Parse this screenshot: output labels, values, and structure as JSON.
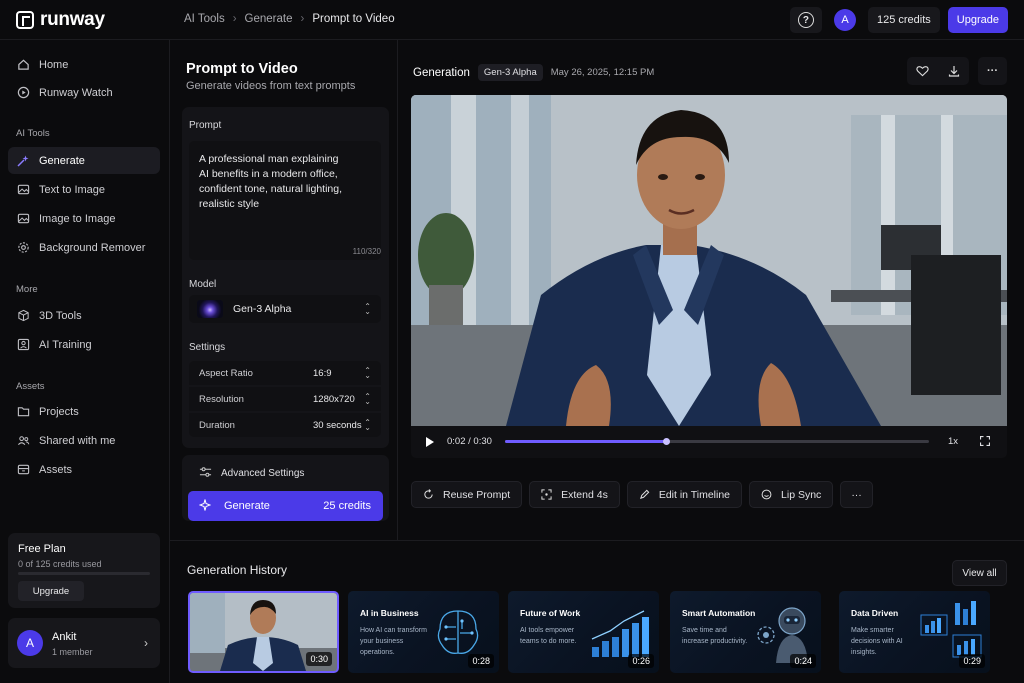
{
  "app": {
    "logo_text": "runway"
  },
  "breadcrumb": [
    "AI Tools",
    "Generate",
    "Prompt to Video"
  ],
  "header": {
    "avatar_initial": "A",
    "credits": "125 credits",
    "upgrade": "Upgrade"
  },
  "sidebar": {
    "top_items": [
      {
        "label": "Home",
        "icon": "home-icon"
      },
      {
        "label": "Runway Watch",
        "icon": "play-circle-icon"
      }
    ],
    "sections": {
      "ai_tools": "AI Tools",
      "more": "More",
      "assets": "Assets"
    },
    "ai_tools": [
      {
        "label": "Generate",
        "icon": "sparkle-icon",
        "active": true
      },
      {
        "label": "Text to Image",
        "icon": "image-icon"
      },
      {
        "label": "Image to Image",
        "icon": "image-icon"
      },
      {
        "label": "Background Remover",
        "icon": "gear-icon"
      }
    ],
    "more": [
      {
        "label": "3D Tools",
        "icon": "cube-icon"
      },
      {
        "label": "AI Training",
        "icon": "training-icon"
      }
    ],
    "assets": [
      {
        "label": "Projects",
        "icon": "folder-icon"
      },
      {
        "label": "Shared with me",
        "icon": "users-icon"
      },
      {
        "label": "Assets",
        "icon": "box-icon"
      }
    ],
    "plan": {
      "title": "Free Plan",
      "usage": "0 of 125 credits used",
      "used_fraction": 0,
      "button": "Upgrade"
    },
    "user": {
      "initial": "A",
      "name": "Ankit",
      "sub": "1 member"
    }
  },
  "panel": {
    "title": "Prompt to Video",
    "subtitle": "Generate videos from text prompts",
    "prompt_label": "Prompt",
    "prompt_text": "A professional man explaining\nAI benefits in a modern office,\nconfident tone, natural lighting,\nrealistic style",
    "counter": "110/320",
    "model_label": "Model",
    "model_value": "Gen-3 Alpha",
    "settings_label": "Settings",
    "settings": [
      {
        "label": "Aspect Ratio",
        "value": "16:9"
      },
      {
        "label": "Resolution",
        "value": "1280x720"
      },
      {
        "label": "Duration",
        "value": "30 seconds"
      }
    ],
    "advanced": "Advanced Settings",
    "generate": "Generate",
    "generate_credits": "25 credits"
  },
  "main": {
    "title": "Generation",
    "badge": "Gen-3 Alpha",
    "date": "May 26, 2025, 12:15 PM",
    "time": "0:02 / 0:30",
    "progress": 0.38,
    "speed": "1x",
    "actions": [
      {
        "label": "Reuse Prompt",
        "icon": "reuse-icon"
      },
      {
        "label": "Extend 4s",
        "icon": "extend-icon"
      },
      {
        "label": "Edit in Timeline",
        "icon": "edit-icon"
      },
      {
        "label": "Lip Sync",
        "icon": "lip-sync-icon"
      }
    ]
  },
  "history": {
    "title": "Generation History",
    "view_all": "View all",
    "items": [
      {
        "title": "",
        "desc": "",
        "duration": "0:30"
      },
      {
        "title": "AI in Business",
        "desc": "How AI can transform your business operations.",
        "duration": "0:28"
      },
      {
        "title": "Future of Work",
        "desc": "AI tools empower teams to do more.",
        "duration": "0:26"
      },
      {
        "title": "Smart Automation",
        "desc": "Save time and increase productivity.",
        "duration": "0:24"
      },
      {
        "title": "Data Driven",
        "desc": "Make smarter decisions with AI insights.",
        "duration": "0:29"
      }
    ]
  },
  "colors": {
    "accent": "#4b3ae8",
    "accent_light": "#6f5cff",
    "bg": "#0b0b0d"
  }
}
